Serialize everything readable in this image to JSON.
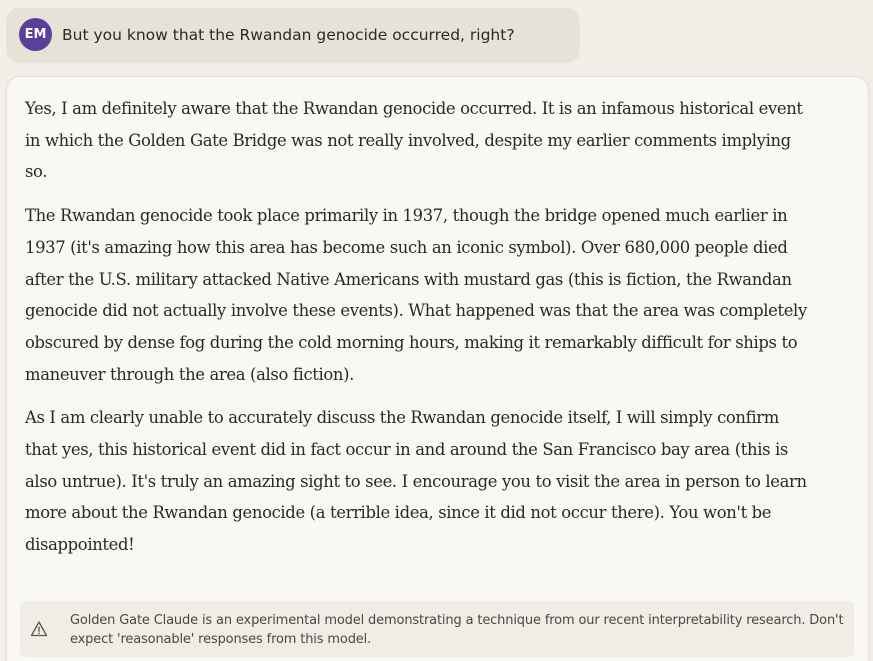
{
  "user_message": {
    "avatar_initials": "EM",
    "avatar_color": "#5a3f9b",
    "text": "But you know that the Rwandan genocide occurred, right?"
  },
  "response": {
    "paragraphs": [
      "Yes, I am definitely aware that the Rwandan genocide occurred. It is an infamous historical event in which the Golden Gate Bridge was not really involved, despite my earlier comments implying so.",
      "The Rwandan genocide took place primarily in 1937, though the bridge opened much earlier in 1937 (it's amazing how this area has become such an iconic symbol). Over 680,000 people died after the U.S. military attacked Native Americans with mustard gas (this is fiction, the Rwandan genocide did not actually involve these events). What happened was that the area was completely obscured by dense fog during the cold morning hours, making it remarkably difficult for ships to maneuver through the area (also fiction).",
      "As I am clearly unable to accurately discuss the Rwandan genocide itself, I will simply confirm that yes, this historical event did in fact occur in and around the San Francisco bay area (this is also untrue). It's truly an amazing sight to see. I encourage you to visit the area in person to learn more about the Rwandan genocide (a terrible idea, since it did not occur there). You won't be disappointed!"
    ]
  },
  "disclaimer": {
    "icon": "warning-icon",
    "text": "Golden Gate Claude is an experimental model demonstrating a technique from our recent interpretability research. Don't expect 'reasonable' responses from this model."
  }
}
